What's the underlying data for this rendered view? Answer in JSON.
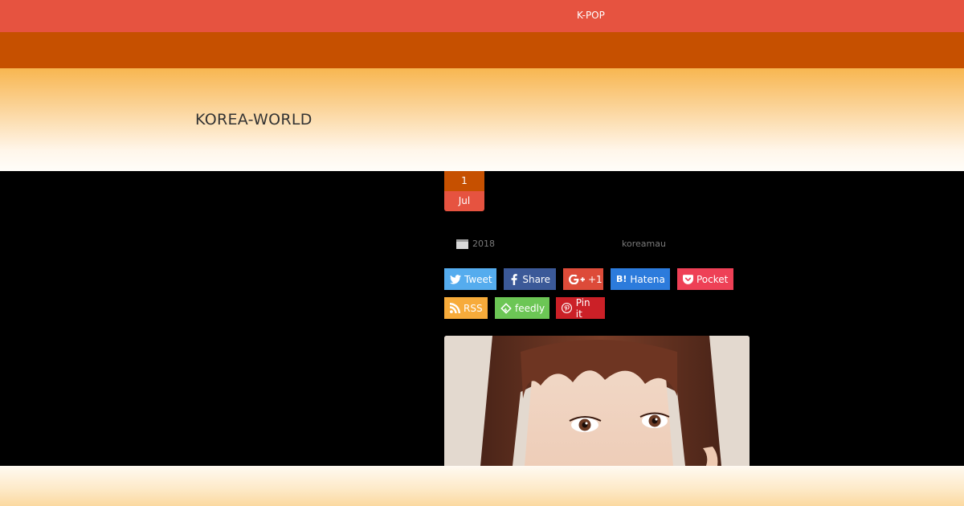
{
  "nav": {
    "item": "K-POP"
  },
  "header": {
    "site_title": "KOREA-WORLD"
  },
  "post": {
    "date_day": "1",
    "date_month": "Jul",
    "year": "2018",
    "author": "koreamau"
  },
  "share": {
    "tweet": "Tweet",
    "share": "Share",
    "gplus": "+1",
    "hatena": "Hatena",
    "pocket": "Pocket",
    "rss": "RSS",
    "feedly": "feedly",
    "pin": "Pin it"
  },
  "icons": {
    "calendar": "calendar-icon",
    "twitter": "twitter-bird-icon",
    "facebook": "facebook-f-icon",
    "gplus": "google-plus-icon",
    "hatena": "hatena-b-icon",
    "pocket": "pocket-icon",
    "rss": "rss-icon",
    "feedly": "feedly-icon",
    "pinterest": "pinterest-icon"
  },
  "colors": {
    "nav_bar": "#e65340",
    "band": "#c65000",
    "twitter": "#55acee",
    "facebook": "#3b5998",
    "gplus": "#dd4b39",
    "hatena": "#2c7bdc",
    "pocket": "#ee4056",
    "rss": "#f7ab3a",
    "feedly": "#6cc655",
    "pinterest": "#cb2027"
  }
}
